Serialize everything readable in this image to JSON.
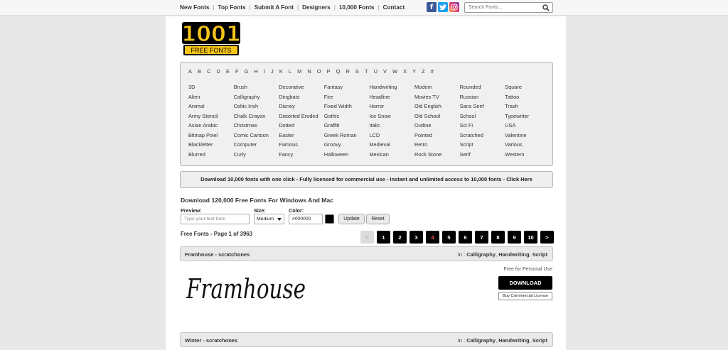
{
  "topnav": {
    "links": [
      "New Fonts",
      "Top Fonts",
      "Submit A Font",
      "Designers",
      "10,000 Fonts",
      "Contact"
    ],
    "social": [
      "facebook-icon",
      "twitter-icon",
      "instagram-icon"
    ],
    "search_placeholder": "Search Fonts..."
  },
  "logo": {
    "big": "1001",
    "small": "FREE FONTS",
    "colors": {
      "primary": "#f5c518",
      "outline": "#000000"
    }
  },
  "alphabet": [
    "A",
    "B",
    "C",
    "D",
    "E",
    "F",
    "G",
    "H",
    "I",
    "J",
    "K",
    "L",
    "M",
    "N",
    "O",
    "P",
    "Q",
    "R",
    "S",
    "T",
    "U",
    "V",
    "W",
    "X",
    "Y",
    "Z",
    "#"
  ],
  "categories": [
    [
      "3D",
      "Alien",
      "Animal",
      "Army Stencil",
      "Asian Arabic",
      "Bitmap Pixel",
      "Blackletter",
      "Blurred"
    ],
    [
      "Brush",
      "Calligraphy",
      "Celtic Irish",
      "Chalk Crayon",
      "Christmas",
      "Comic Cartoon",
      "Computer",
      "Curly"
    ],
    [
      "Decorative",
      "Dingbats",
      "Disney",
      "Distorted Eroded",
      "Dotted",
      "Easter",
      "Famous",
      "Fancy"
    ],
    [
      "Fantasy",
      "Fire",
      "Fixed Width",
      "Gothic",
      "Graffiti",
      "Greek Roman",
      "Groovy",
      "Halloween"
    ],
    [
      "Handwriting",
      "Headline",
      "Horror",
      "Ice Snow",
      "Italic",
      "LCD",
      "Medieval",
      "Mexican"
    ],
    [
      "Modern",
      "Movies TV",
      "Old English",
      "Old School",
      "Outline",
      "Pointed",
      "Retro",
      "Rock Stone"
    ],
    [
      "Rounded",
      "Russian",
      "Sans Serif",
      "School",
      "Sci Fi",
      "Scratched",
      "Script",
      "Serif"
    ],
    [
      "Square",
      "Tattoo",
      "Trash",
      "Typewriter",
      "USA",
      "Valentine",
      "Various",
      "Western"
    ]
  ],
  "promo": "Download 10,000 fonts with one click - Fully licensed for commercial use - Instant and unlimited access to 10,000 fonts - Click Here",
  "heading": "Download 120,000 Free Fonts For Windows And Mac",
  "controls": {
    "preview_label": "Preview:",
    "preview_placeholder": "Type your text here",
    "size_label": "Size:",
    "size_value": "Medium",
    "color_label": "Color:",
    "color_value": "#000000",
    "update_label": "Update",
    "reset_label": "Reset"
  },
  "page_info": "Free Fonts - Page 1 of 3963",
  "pager": {
    "prev": "<",
    "pages": [
      "1",
      "2",
      "3",
      "4",
      "5",
      "6",
      "7",
      "8",
      "9",
      "10"
    ],
    "next": ">",
    "current": "4"
  },
  "fonts": [
    {
      "name": "Framhouse - scratchones",
      "in_label": "in :",
      "categories": [
        "Calligraphy",
        "Handwriting",
        "Script"
      ],
      "preview_text": "Framhouse",
      "license": "Free for Personal Use",
      "download_label": "DOWNLOAD",
      "commercial_label": "Buy Commercial License"
    },
    {
      "name": "Winter - scratchones",
      "in_label": "in :",
      "categories": [
        "Calligraphy",
        "Handwriting",
        "Script"
      ]
    }
  ]
}
